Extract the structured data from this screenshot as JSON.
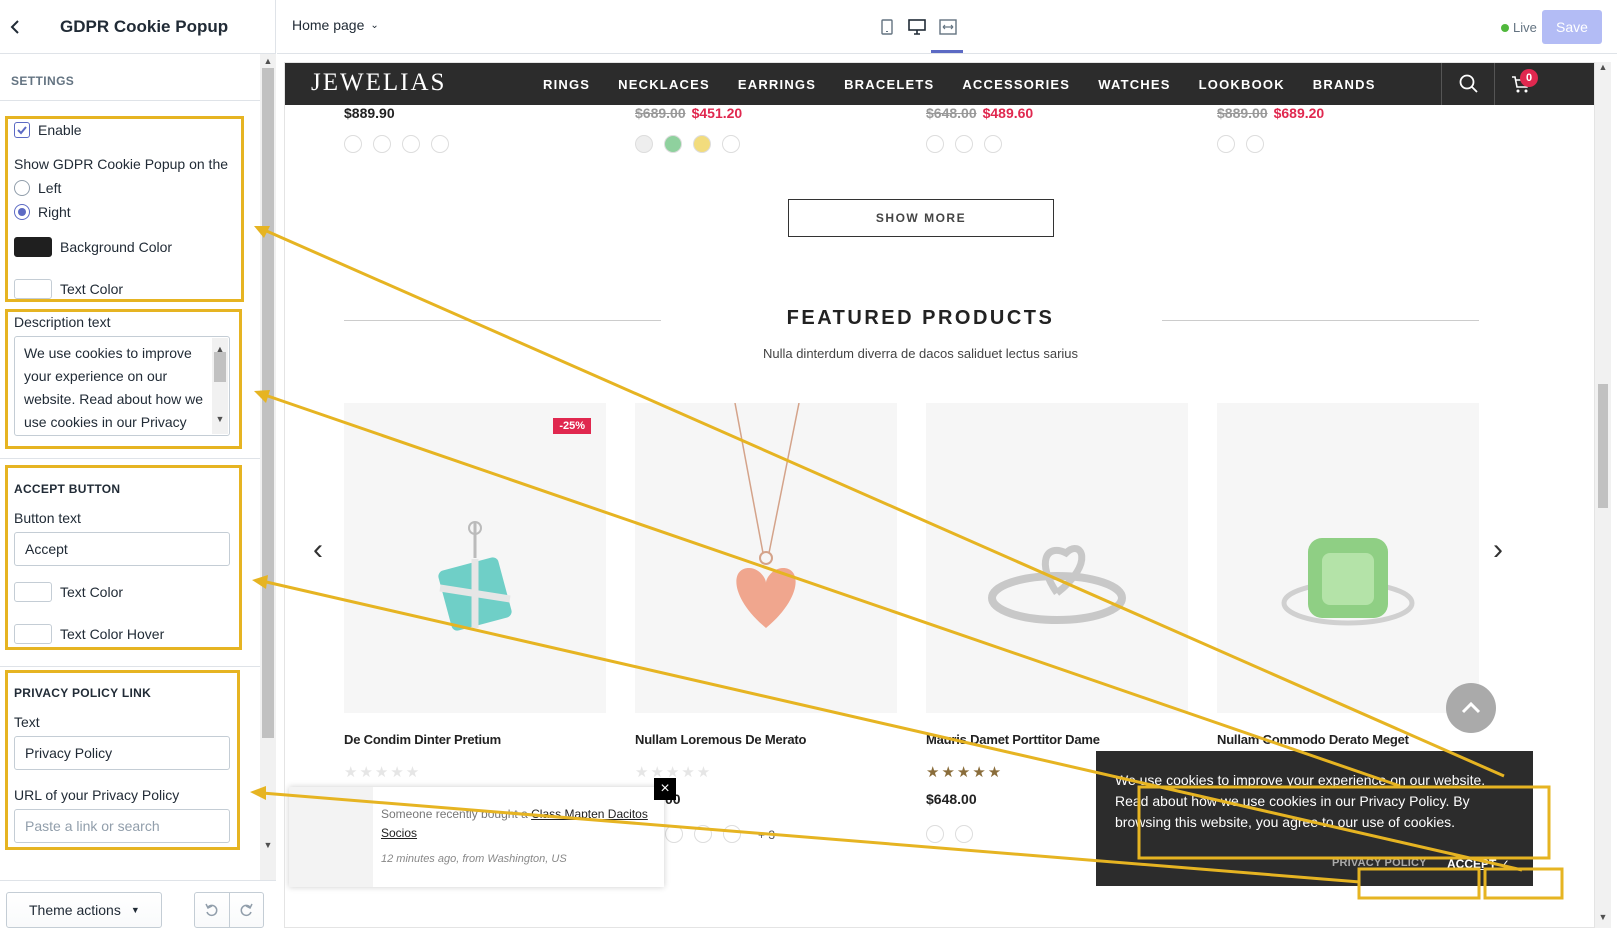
{
  "sidebar": {
    "title": "GDPR Cookie Popup",
    "settings_label": "SETTINGS",
    "enable_label": "Enable",
    "position_label": "Show GDPR Cookie Popup on the",
    "position_options": [
      "Left",
      "Right"
    ],
    "position_selected": "Right",
    "bg_color_label": "Background Color",
    "text_color_label": "Text Color",
    "description_label": "Description text",
    "description_value": "We use cookies to improve your experience on our website. Read about how we use cookies in our Privacy",
    "accept_section": "ACCEPT BUTTON",
    "button_text_label": "Button text",
    "button_text_value": "Accept",
    "accept_text_color": "Text Color",
    "accept_text_color_hover": "Text Color Hover",
    "privacy_section": "PRIVACY POLICY LINK",
    "privacy_text_label": "Text",
    "privacy_text_value": "Privacy Policy",
    "privacy_url_label": "URL of your Privacy Policy",
    "privacy_url_placeholder": "Paste a link or search",
    "theme_actions": "Theme actions"
  },
  "topbar": {
    "page": "Home page",
    "live": "Live",
    "save": "Save"
  },
  "store": {
    "logo": "JEWELIAS",
    "nav": [
      "RINGS",
      "NECKLACES",
      "EARRINGS",
      "BRACELETS",
      "ACCESSORIES",
      "WATCHES",
      "LOOKBOOK",
      "BRANDS"
    ],
    "cart_count": "0",
    "top_prices": [
      {
        "old": "",
        "new": "$889.90"
      },
      {
        "old": "$689.00",
        "new": "$451.20"
      },
      {
        "old": "$648.00",
        "new": "$489.60"
      },
      {
        "old": "$889.00",
        "new": "$689.20"
      }
    ],
    "show_more": "SHOW MORE",
    "featured_title": "FEATURED PRODUCTS",
    "featured_sub": "Nulla dinterdum diverra de dacos saliduet lectus sarius",
    "products": [
      {
        "name": "De Condim Dinter Pretium",
        "badge": "-25%"
      },
      {
        "name": "Nullam Loremous De Merato",
        "price": "00"
      },
      {
        "name": "Mauris Damet Porttitor Dame",
        "price": "$648.00"
      },
      {
        "name": "Nullam Commodo Derato Meget"
      }
    ],
    "more_colors": "+ 3",
    "notification": {
      "prefix": "Someone recently bought a",
      "product": "Class Mapten Dacitos Socios",
      "meta": "12 minutes ago, from Washington, US"
    },
    "gdpr": {
      "text": "We use cookies to improve your experience on our website. Read about how we use cookies in our Privacy Policy. By browsing this website, you agree to our use of cookies.",
      "privacy": "PRIVACY POLICY",
      "accept": "ACCEPT"
    }
  },
  "colors": {
    "accent": "#5c6ac4",
    "highlight": "#e6b422",
    "sale": "#e0284f",
    "popup_bg": "#2c2c2c"
  }
}
